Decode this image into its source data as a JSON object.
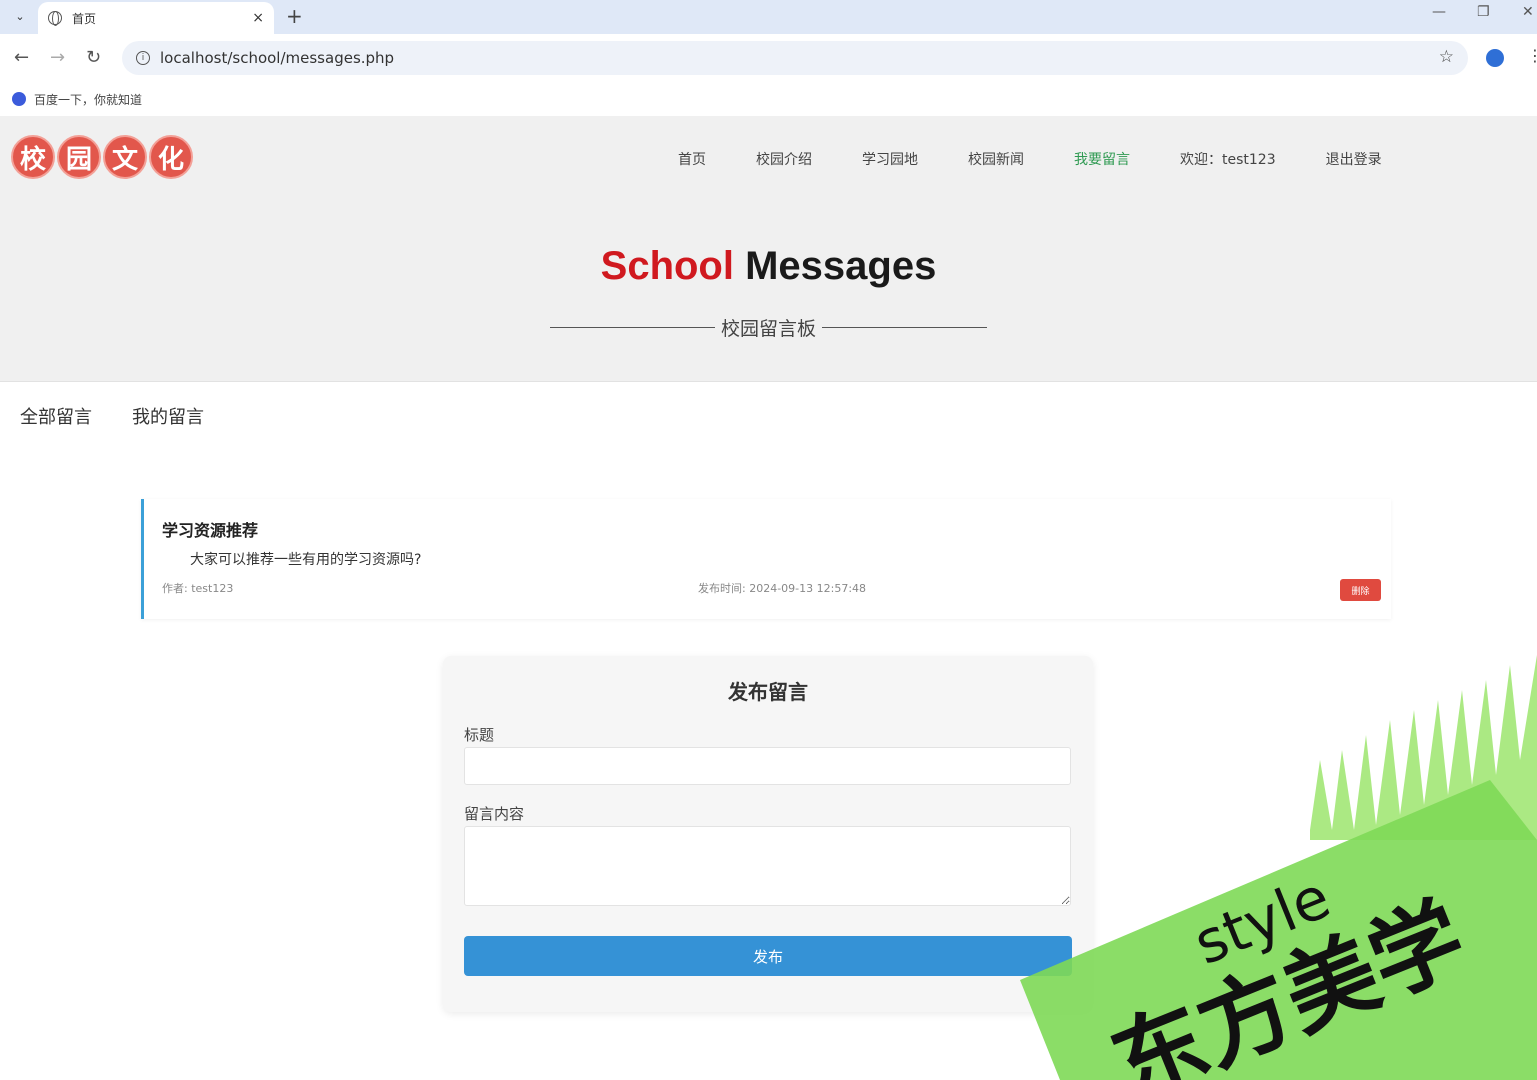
{
  "browser": {
    "tab_title": "首页",
    "url": "localhost/school/messages.php",
    "bookmark": "百度一下，你就知道",
    "new_tab": "+",
    "close": "×"
  },
  "site": {
    "logo_chars": [
      "校",
      "园",
      "文",
      "化"
    ],
    "nav": [
      "首页",
      "校园介绍",
      "学习园地",
      "校园新闻",
      "我要留言",
      "欢迎：test123",
      "退出登录"
    ],
    "active_nav": "我要留言",
    "hero_title_red": "School",
    "hero_title_dark": "Messages",
    "hero_subtitle": "校园留言板"
  },
  "tabs": [
    "全部留言",
    "我的留言"
  ],
  "messages": [
    {
      "title": "学习资源推荐",
      "content": "大家可以推荐一些有用的学习资源吗?",
      "author": "作者: test123",
      "time": "发布时间: 2024-09-13 12:57:48",
      "delete_label": "删除"
    }
  ],
  "form": {
    "heading": "发布留言",
    "title_label": "标题",
    "content_label": "留言内容",
    "submit_label": "发布"
  },
  "watermark": {
    "text_style": "style",
    "text_cn": "东方美学"
  },
  "colors": {
    "accent_blue": "#3592d6",
    "card_border": "#3ba0d8",
    "logo_red": "#e2574c",
    "hero_red": "#d0191f",
    "active_green": "#2f9a52",
    "delete_red": "#e04a3f",
    "watermark_green": "#7ed957"
  }
}
